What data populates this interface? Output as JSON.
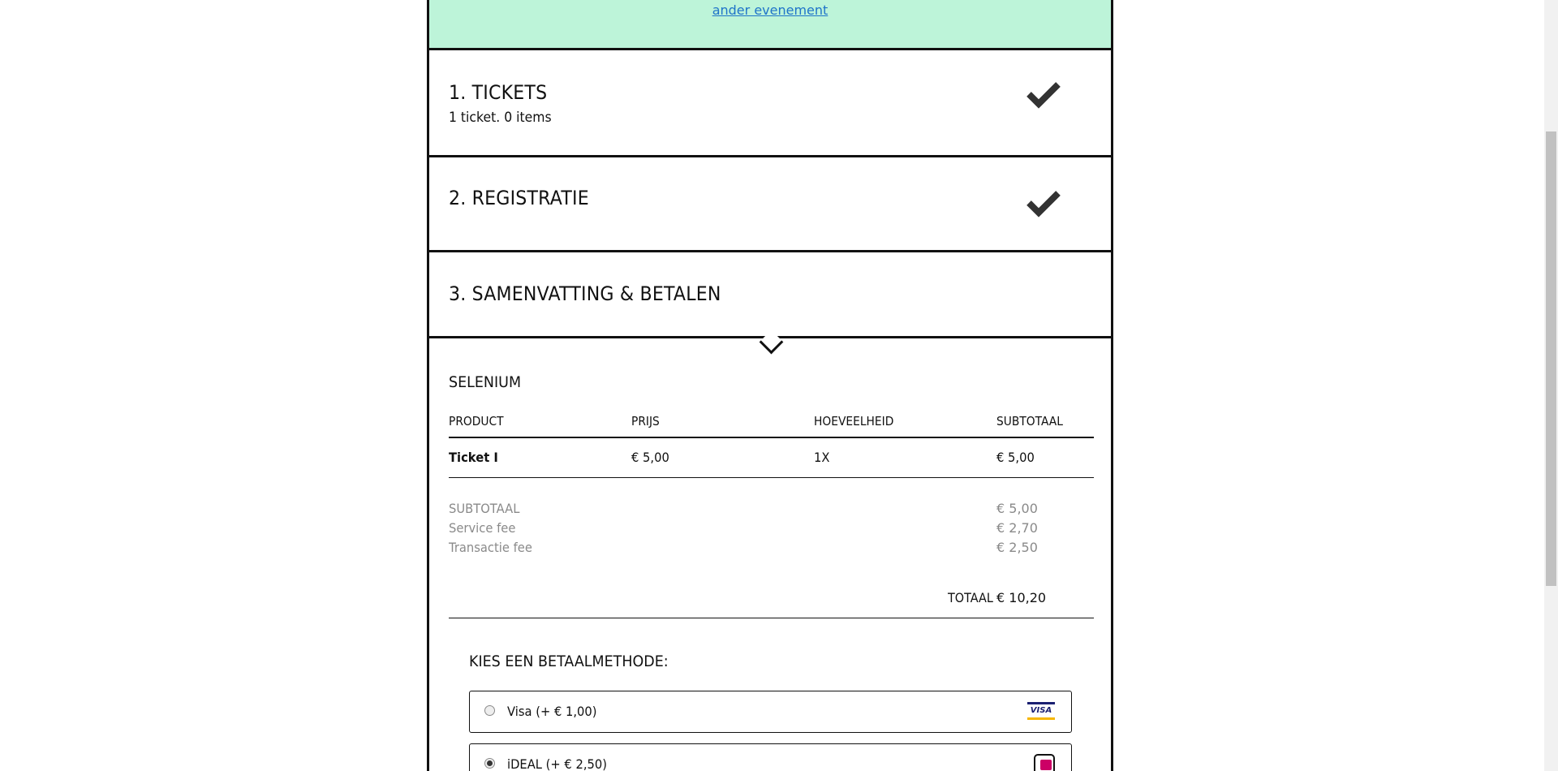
{
  "banner": {
    "link": "ander evenement"
  },
  "steps": [
    {
      "title": "1. TICKETS",
      "subtitle": "1 ticket. 0 items",
      "completed": true
    },
    {
      "title": "2. REGISTRATIE",
      "completed": true
    },
    {
      "title": "3. SAMENVATTING & BETALEN",
      "completed": false
    }
  ],
  "summary": {
    "event": "SELENIUM",
    "headers": [
      "PRODUCT",
      "PRIJS",
      "HOEVEELHEID",
      "SUBTOTAAL"
    ],
    "row": {
      "product": "Ticket I",
      "price": "€ 5,00",
      "qty": "1X",
      "subtotal": "€ 5,00"
    },
    "fees": [
      {
        "label": "SUBTOTAAL",
        "value": "€ 5,00"
      },
      {
        "label": "Service fee",
        "value": "€ 2,70"
      },
      {
        "label": "Transactie fee",
        "value": "€ 2,50"
      }
    ],
    "total_label": "TOTAAL",
    "total_value": "€ 10,20"
  },
  "payment": {
    "title": "KIES EEN BETAALMETHODE:",
    "options": [
      {
        "label": "Visa (+ € 1,00)",
        "icon": "visa-logo",
        "selected": false,
        "logo_text": "VISA"
      },
      {
        "label": "iDEAL (+ € 2,50)",
        "icon": "ideal-logo",
        "selected": true
      }
    ]
  }
}
